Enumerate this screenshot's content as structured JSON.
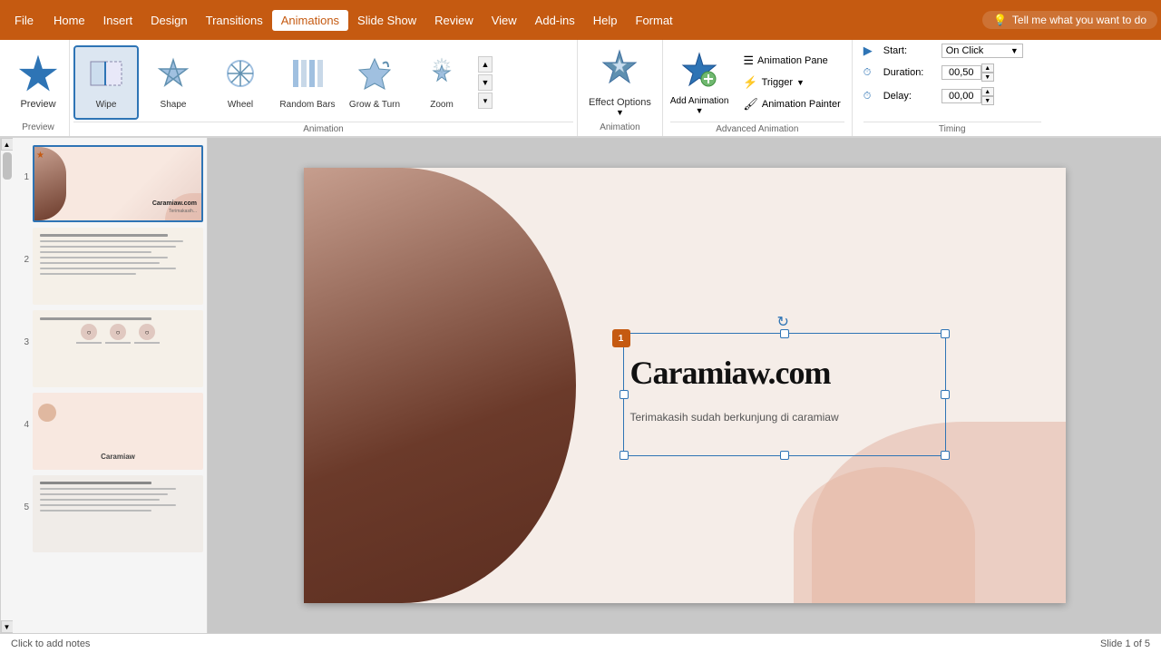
{
  "app": {
    "title": "PowerPoint"
  },
  "menubar": {
    "file": "File",
    "items": [
      {
        "label": "Home",
        "active": false
      },
      {
        "label": "Insert",
        "active": false
      },
      {
        "label": "Design",
        "active": false
      },
      {
        "label": "Transitions",
        "active": false
      },
      {
        "label": "Animations",
        "active": true
      },
      {
        "label": "Slide Show",
        "active": false
      },
      {
        "label": "Review",
        "active": false
      },
      {
        "label": "View",
        "active": false
      },
      {
        "label": "Add-ins",
        "active": false
      },
      {
        "label": "Help",
        "active": false
      },
      {
        "label": "Format",
        "active": false
      }
    ],
    "tell_me": "Tell me what you want to do"
  },
  "ribbon": {
    "preview": {
      "label": "Preview",
      "section_label": "Preview"
    },
    "animations": {
      "section_label": "Animation",
      "items": [
        {
          "name": "Wipe",
          "selected": true
        },
        {
          "name": "Shape"
        },
        {
          "name": "Wheel"
        },
        {
          "name": "Random Bars"
        },
        {
          "name": "Grow & Turn"
        },
        {
          "name": "Zoom"
        }
      ]
    },
    "effect_options": {
      "label": "Effect Options",
      "section_label": "Animation"
    },
    "advanced": {
      "add_animation": "Add Animation",
      "animation_pane": "Animation Pane",
      "trigger": "Trigger",
      "animation_painter": "Animation Painter",
      "section_label": "Advanced Animation"
    },
    "timing": {
      "start_label": "Start:",
      "start_value": "On Click",
      "duration_label": "Duration:",
      "duration_value": "00,50",
      "delay_label": "Delay:",
      "delay_value": "00,00",
      "section_label": "Timing"
    }
  },
  "slides": [
    {
      "number": "1",
      "selected": true
    },
    {
      "number": "2"
    },
    {
      "number": "3"
    },
    {
      "number": "4"
    },
    {
      "number": "5"
    }
  ],
  "slide_content": {
    "title": "Caramiaw.com",
    "subtitle": "Terimakasih sudah berkunjung di caramiaw"
  },
  "statusbar": {
    "notes_placeholder": "Click to add notes",
    "slide_count": "Slide 1 of 5"
  }
}
